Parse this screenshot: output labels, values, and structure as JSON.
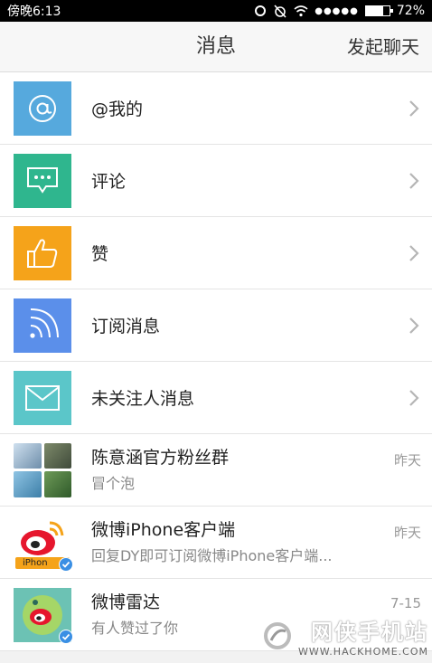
{
  "status": {
    "carrier": "傍晚6:13",
    "battery": "72%",
    "battery_level": 0.72
  },
  "header": {
    "title": "消息",
    "action": "发起聊天"
  },
  "rows": [
    {
      "label": "@我的",
      "icon": "at-icon",
      "color": "#56a9dd"
    },
    {
      "label": "评论",
      "icon": "comment-icon",
      "color": "#2fb68e"
    },
    {
      "label": "赞",
      "icon": "thumbs-up-icon",
      "color": "#f5a31a"
    },
    {
      "label": "订阅消息",
      "icon": "rss-icon",
      "color": "#5b8fea"
    },
    {
      "label": "未关注人消息",
      "icon": "mail-icon",
      "color": "#5bc6c9"
    }
  ],
  "conversations": [
    {
      "title": "陈意涵官方粉丝群",
      "subtitle": "冒个泡",
      "time": "昨天"
    },
    {
      "title": "微博iPhone客户端",
      "subtitle": "回复DY即可订阅微博iPhone客户端...",
      "time": "昨天",
      "badge": "iPhon"
    },
    {
      "title": "微博雷达",
      "subtitle": "有人赞过了你",
      "time": "7-15"
    }
  ],
  "watermark": {
    "brand": "网侠手机站",
    "url": "WWW.HACKHOME.COM"
  }
}
